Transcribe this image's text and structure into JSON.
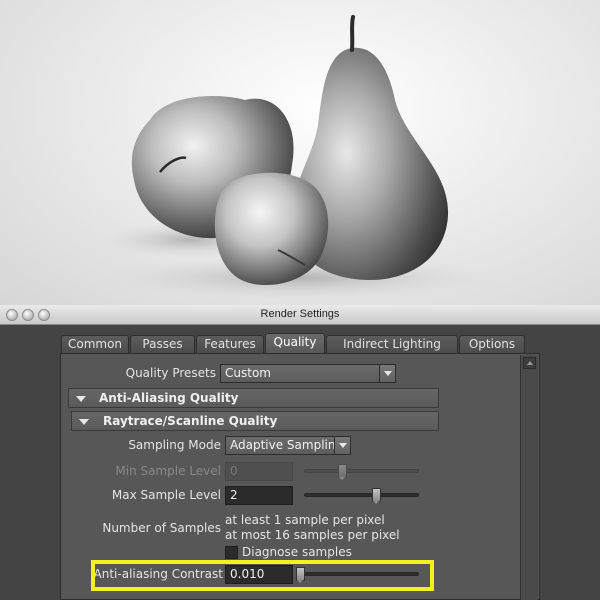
{
  "preview": {
    "description_icon": "render-preview-image"
  },
  "window": {
    "title": "Render Settings"
  },
  "tabs": [
    {
      "label": "Common",
      "active": false
    },
    {
      "label": "Passes",
      "active": false
    },
    {
      "label": "Features",
      "active": false
    },
    {
      "label": "Quality",
      "active": true
    },
    {
      "label": "Indirect Lighting",
      "active": false
    },
    {
      "label": "Options",
      "active": false
    }
  ],
  "quality": {
    "presets_label": "Quality Presets",
    "presets_value": "Custom",
    "section_antialiasing": "Anti-Aliasing Quality",
    "section_raytrace": "Raytrace/Scanline Quality",
    "sampling_mode_label": "Sampling Mode",
    "sampling_mode_value": "Adaptive Sampling",
    "min_sample_level_label": "Min Sample Level",
    "min_sample_level_value": "0",
    "min_sample_level_slider": 0.33,
    "max_sample_level_label": "Max Sample Level",
    "max_sample_level_value": "2",
    "max_sample_level_slider": 0.63,
    "num_samples_label": "Number of Samples",
    "num_samples_line1": "at least 1 sample per pixel",
    "num_samples_line2": "at most 16 samples per pixel",
    "diagnose_label": "Diagnose samples",
    "diagnose_checked": false,
    "aa_contrast_label": "Anti-aliasing Contrast",
    "aa_contrast_value": "0.010",
    "aa_contrast_slider": 0.02
  },
  "colors": {
    "highlight": "#f4f21c"
  }
}
